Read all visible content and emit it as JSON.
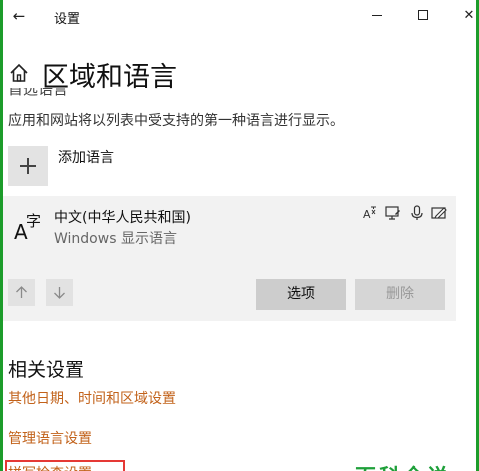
{
  "window": {
    "title": "设置",
    "back_glyph": "←",
    "close_glyph": "✕"
  },
  "header": {
    "title": "区域和语言",
    "clipped_heading": "首选语言"
  },
  "languages_section": {
    "description": "应用和网站将以列表中受支持的第一种语言进行显示。",
    "add_label": "添加语言"
  },
  "language_item": {
    "glyph_latin": "A",
    "glyph_cjk": "字",
    "name": "中文(中华人民共和国)",
    "subtitle": "Windows 显示语言",
    "feature_icons": [
      "language-pack-icon",
      "display-icon",
      "microphone-icon",
      "handwriting-icon"
    ],
    "options_label": "选项",
    "remove_label": "删除"
  },
  "related": {
    "title": "相关设置",
    "links": [
      "其他日期、时间和区域设置",
      "管理语言设置",
      "拼写检查设置"
    ]
  },
  "watermark": {
    "text": "百科全说"
  },
  "colors": {
    "accent_green": "#1c9c2a",
    "link_orange": "#c2621a",
    "highlight_red": "#e53935"
  }
}
